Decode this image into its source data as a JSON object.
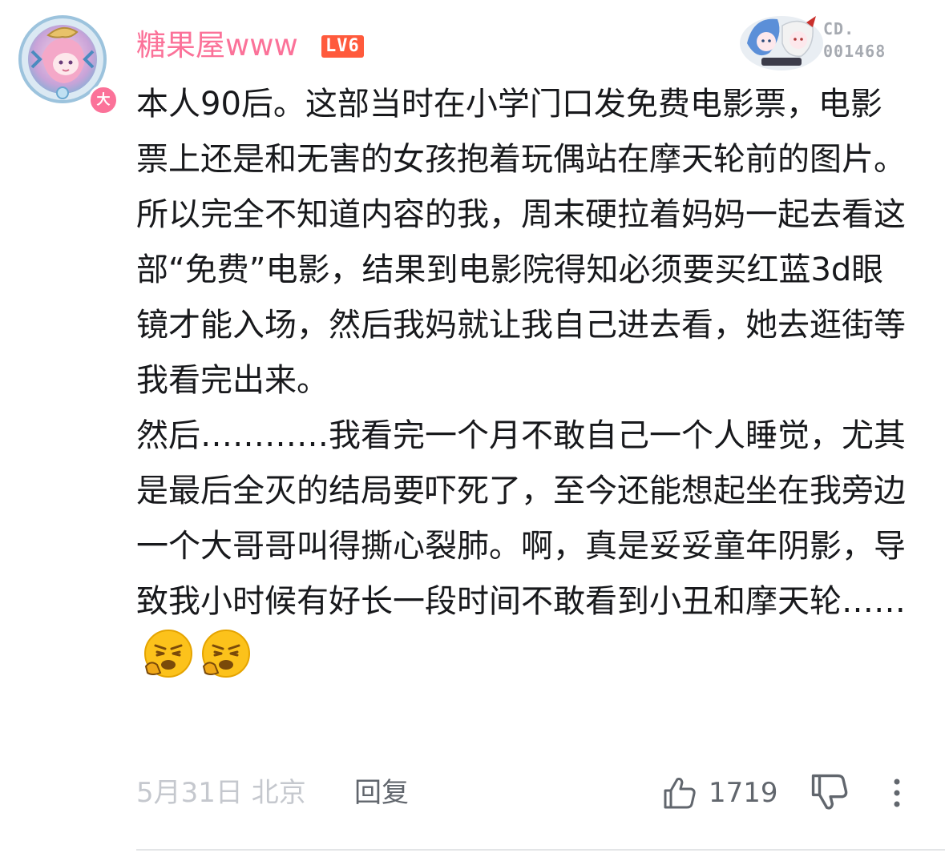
{
  "user": {
    "name": "糖果屋www",
    "level": "LV6",
    "vip_badge": "大",
    "avatar": "anime-girl-avatar-with-frame"
  },
  "fan_badge": {
    "image": "anime-characters-badge",
    "label": "CD.",
    "number": "001468"
  },
  "comment": {
    "paragraph1": "本人90后。这部当时在小学门口发免费电影票，电影票上还是和无害的女孩抱着玩偶站在摩天轮前的图片。所以完全不知道内容的我，周末硬拉着妈妈一起去看这部“免费”电影，结果到电影院得知必须要买红蓝3d眼镜才能入场，然后我妈就让我自己进去看，她去逛街等我看完出来。",
    "paragraph2": "然后…………我看完一个月不敢自己一个人睡觉，尤其是最后全灭的结局要吓死了，至今还能想起坐在我旁边一个大哥哥叫得撕心裂肺。啊，真是妥妥童年阴影，导致我小时候有好长一段时间不敢看到小丑和摩天轮……",
    "emojis": [
      "tired-face-emoji",
      "tired-face-emoji"
    ]
  },
  "footer": {
    "date_location": "5月31日  北京",
    "reply_label": "回复",
    "like_count": "1719",
    "like_icon": "thumbs-up-icon",
    "dislike_icon": "thumbs-down-icon",
    "more_icon": "more-vertical-icon"
  },
  "colors": {
    "username": "#fb7299",
    "level_badge": "#ff5a3c",
    "meta_text": "#c5c8ce",
    "action_text": "#61666d",
    "body_text": "#18191c"
  }
}
